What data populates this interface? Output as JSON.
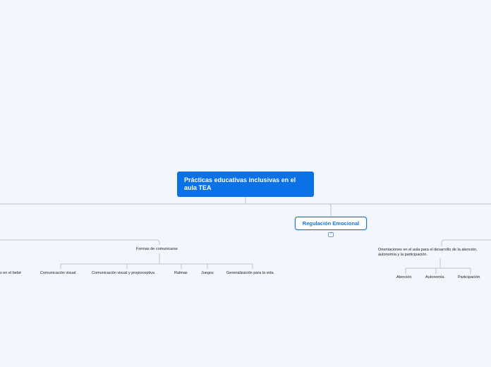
{
  "root": {
    "title": "Prácticas educativas inclusivas en el aula TEA"
  },
  "regulation": {
    "title": "Regulación Emocional",
    "count_badge": "7"
  },
  "communication": {
    "heading": "Formas de comunicarse",
    "children": [
      "s en el bebé",
      "Comunicación visual",
      "Comunicación visual y propioceptiva",
      "Rutinas",
      "Juegos",
      "Generalización para la vida"
    ]
  },
  "orientations": {
    "heading_line1": "Orientaciones en el aula para el desarrollo de la atención,",
    "heading_line2": "autonomía y la participación.",
    "children": [
      "Atención",
      "Autonomía",
      "Participación"
    ]
  }
}
